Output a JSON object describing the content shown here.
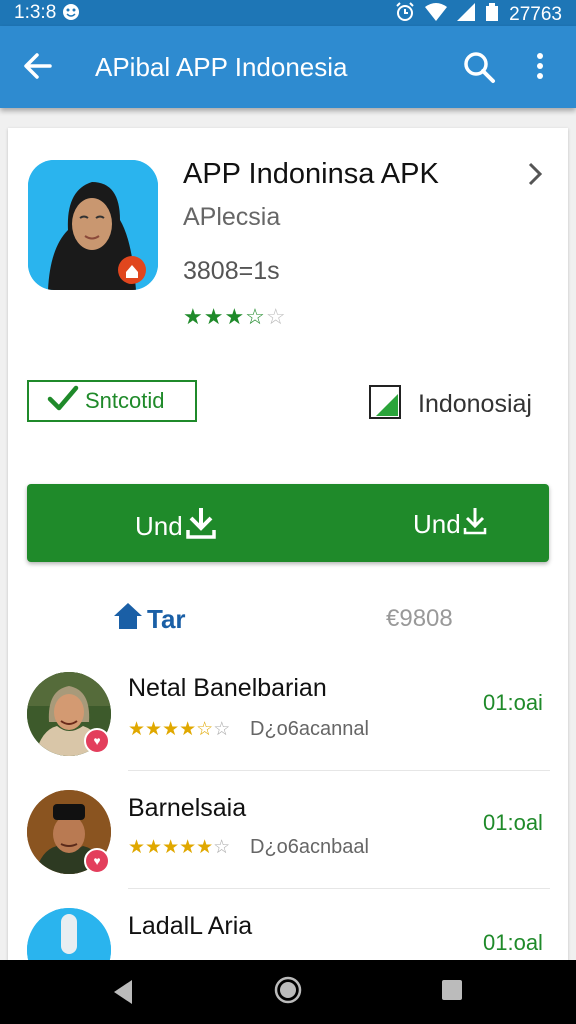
{
  "status_bar": {
    "time": "1:3:8",
    "battery": "27763"
  },
  "appbar": {
    "title": "APibal APP Indonesia"
  },
  "app": {
    "name": "APP Indoninsa APK",
    "developer": "APlecsia",
    "size": "3808=1s",
    "rating": 3.5,
    "verified_label": "Sntcotid",
    "country_label": "Indonosiaj"
  },
  "install": {
    "left_label": "Und",
    "right_label": "Und"
  },
  "tags": {
    "label": "Tar",
    "count": "€9808"
  },
  "reviews": [
    {
      "name": "Netal Banelbarian",
      "stars": 3.5,
      "meta": "D¿o6acannal",
      "time": "01:oai"
    },
    {
      "name": "Barnelsaia",
      "stars": 4.5,
      "meta": "D¿o6acnbaal",
      "time": "01:oal"
    },
    {
      "name": "LadalL Aria",
      "stars": 0,
      "meta": "",
      "time": "01:oal"
    }
  ],
  "colors": {
    "appbar": "#2e8bd0",
    "statusbar": "#1e76b6",
    "accent_green": "#1f8a2a",
    "link_blue": "#1a5fa6"
  }
}
